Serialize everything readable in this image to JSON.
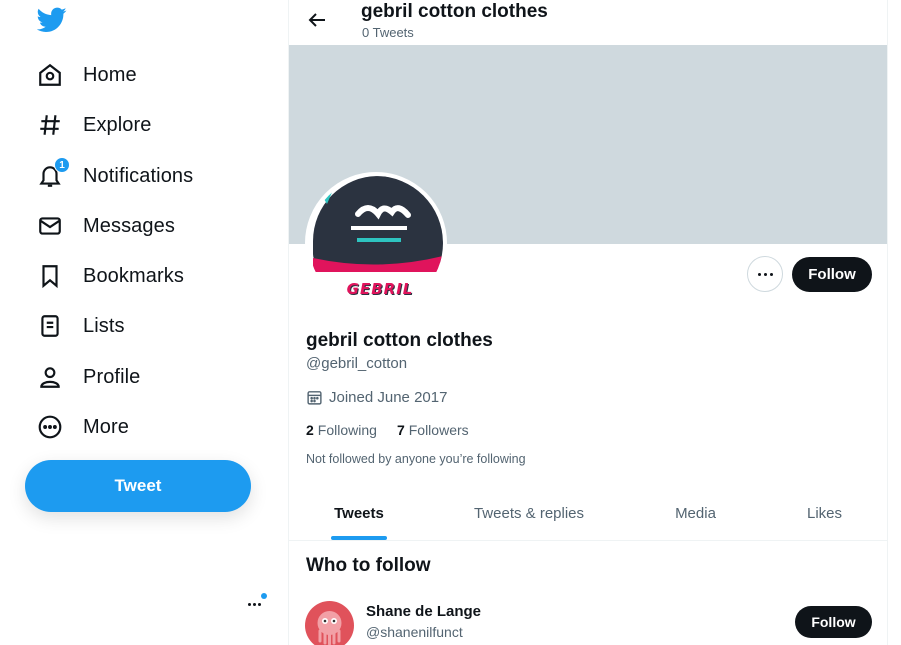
{
  "sidebar": {
    "items": [
      {
        "label": "Home"
      },
      {
        "label": "Explore"
      },
      {
        "label": "Notifications",
        "badge": "1"
      },
      {
        "label": "Messages"
      },
      {
        "label": "Bookmarks"
      },
      {
        "label": "Lists"
      },
      {
        "label": "Profile"
      },
      {
        "label": "More"
      }
    ],
    "tweet_label": "Tweet"
  },
  "header": {
    "title": "gebril cotton clothes",
    "subtitle": "0 Tweets"
  },
  "avatar": {
    "logo_text": "GEBRIL"
  },
  "profile": {
    "name": "gebril cotton clothes",
    "handle": "@gebril_cotton",
    "joined": "Joined June 2017",
    "following_count": "2",
    "following_label": "Following",
    "followers_count": "7",
    "followers_label": "Followers",
    "note": "Not followed by anyone you’re following",
    "follow_label": "Follow"
  },
  "tabs": [
    {
      "label": "Tweets",
      "active": true
    },
    {
      "label": "Tweets & replies"
    },
    {
      "label": "Media"
    },
    {
      "label": "Likes"
    }
  ],
  "who_to_follow": {
    "title": "Who to follow",
    "users": [
      {
        "name": "Shane de Lange",
        "handle": "@shanenilfunct",
        "follow_label": "Follow"
      }
    ]
  },
  "colors": {
    "accent": "#1d9bf0",
    "text": "#0f1419",
    "muted": "#536471",
    "banner": "#cfd9de"
  }
}
